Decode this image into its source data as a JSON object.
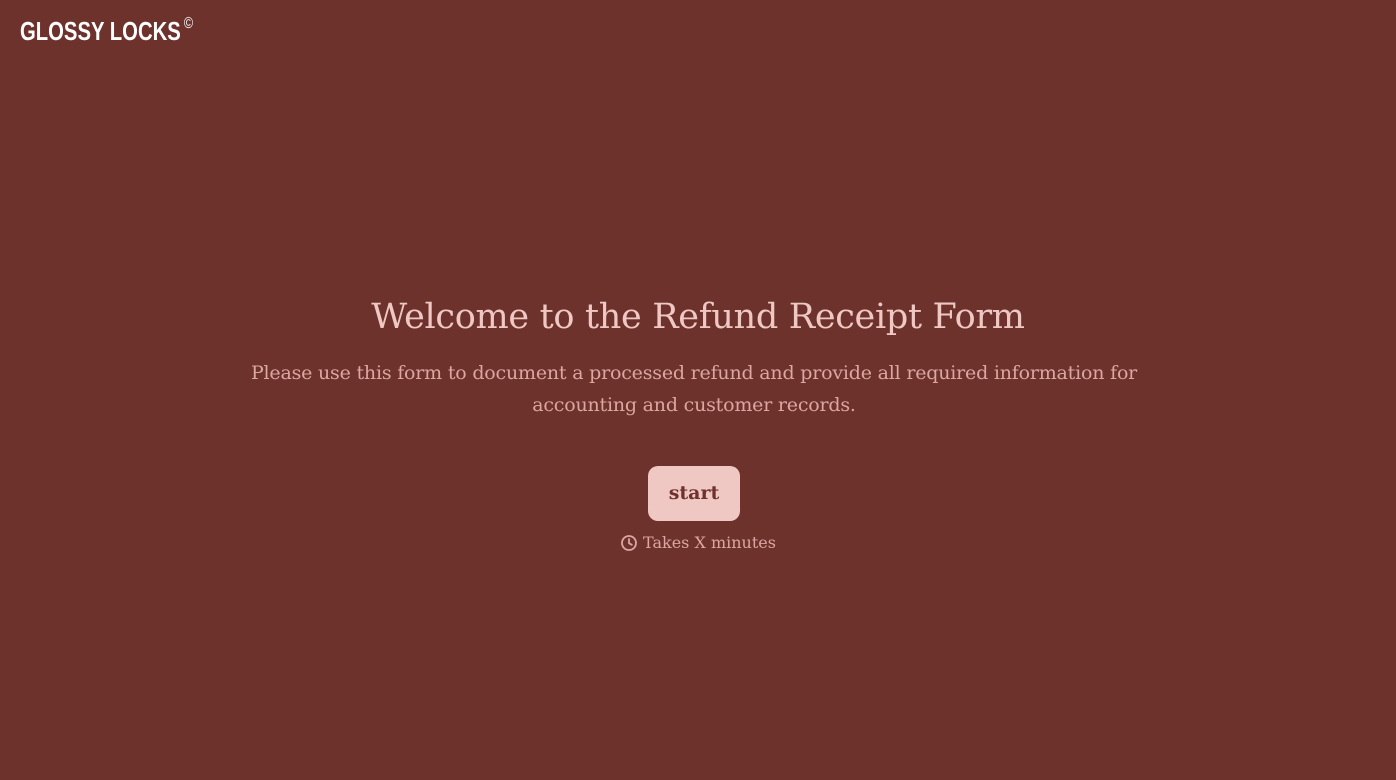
{
  "brand": {
    "name": "GLOSSY LOCKS",
    "mark": "©"
  },
  "welcome": {
    "title": "Welcome to the Refund Receipt Form",
    "description": "Please use this form to document a processed refund and provide all required information for accounting and customer records.",
    "start_label": "start",
    "duration_icon": "clock-icon",
    "duration_text": "Takes X minutes"
  },
  "colors": {
    "background": "#6e322d",
    "accent": "#f0c8c3",
    "muted_text": "#dba7a1",
    "logo": "#ffffff"
  }
}
